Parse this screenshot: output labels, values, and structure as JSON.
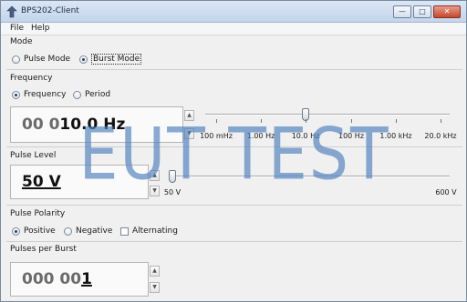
{
  "window": {
    "title": "BPS202-Client",
    "minimize": "—",
    "maximize": "□",
    "close": "✕"
  },
  "menu": [
    "File",
    "Help"
  ],
  "mode": {
    "title": "Mode",
    "options": [
      {
        "label": "Pulse Mode",
        "selected": false
      },
      {
        "label": "Burst Mode",
        "selected": true
      }
    ]
  },
  "frequency": {
    "title": "Frequency",
    "options": [
      {
        "label": "Frequency",
        "selected": true
      },
      {
        "label": "Period",
        "selected": false
      }
    ],
    "value_dim": "00 0",
    "value_bold": "10.0 Hz",
    "slider_value": "10.0 Hz",
    "ticks": [
      "100 mHz",
      "1.00 Hz",
      "10.0 Hz",
      "100 Hz",
      "1.00 kHz",
      "20.0 kHz"
    ]
  },
  "pulse_level": {
    "title": "Pulse Level",
    "value": "50 V",
    "min_label": "50 V",
    "max_label": "600 V",
    "level_fraction": 0
  },
  "pulse_polarity": {
    "title": "Pulse Polarity",
    "options": [
      {
        "label": "Positive",
        "selected": true
      },
      {
        "label": "Negative",
        "selected": false
      }
    ],
    "alternating_label": "Alternating",
    "alternating_checked": false
  },
  "pulses_per_burst": {
    "title": "Pulses per Burst",
    "value_dim": "000 00",
    "value_bold": "1"
  },
  "icons": {
    "app": "app-icon",
    "spin_up": "spin-up-icon",
    "spin_down": "spin-down-icon"
  },
  "watermark": "EUT TEST",
  "colors": {
    "accent": "#1f3f74",
    "watermark": "#5082be"
  }
}
